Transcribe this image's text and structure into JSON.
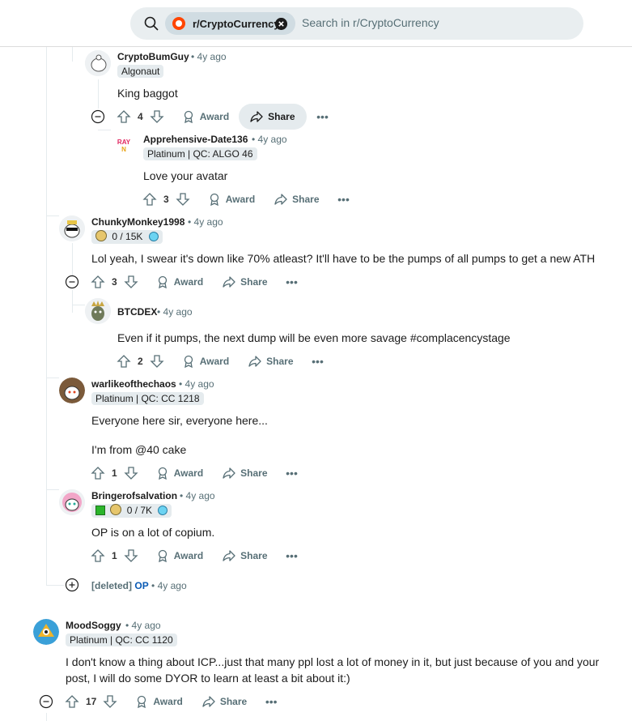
{
  "search": {
    "community": "r/CryptoCurrency",
    "placeholder": "Search in r/CryptoCurrency"
  },
  "comments": [
    {
      "id": "c1",
      "username": "CryptoBumGuy",
      "time": "• 4y ago",
      "flair": "Algonaut",
      "body": "King baggot",
      "votes": "4",
      "award": "Award",
      "share": "Share"
    },
    {
      "id": "c2",
      "username": "Apprehensive-Date136",
      "time": "• 4y ago",
      "flair": "Platinum | QC: ALGO 46",
      "body": "Love your avatar",
      "votes": "3",
      "award": "Award",
      "share": "Share",
      "avatar_text": "RAY N"
    },
    {
      "id": "c3",
      "username": "ChunkyMonkey1998",
      "time": "• 4y ago",
      "flair": "0 / 15K",
      "body": "Lol yeah, I swear it's down like 70% atleast? It'll have to be the pumps of all pumps to get a new ATH",
      "votes": "3",
      "award": "Award",
      "share": "Share"
    },
    {
      "id": "c4",
      "username": "BTCDEX",
      "time": "• 4y ago",
      "body": "Even if it pumps, the next dump will be even more savage #complacencystage",
      "votes": "2",
      "award": "Award",
      "share": "Share"
    },
    {
      "id": "c5",
      "username": "warlikeofthechaos",
      "time": "• 4y ago",
      "flair": "Platinum | QC: CC 1218",
      "body_line1": "Everyone here sir, everyone here...",
      "body_line2": "I'm from @40 cake",
      "votes": "1",
      "award": "Award",
      "share": "Share"
    },
    {
      "id": "c6",
      "username": "Bringerofsalvation",
      "time": "• 4y ago",
      "flair": "0 / 7K",
      "body": "OP is on a lot of copium.",
      "votes": "1",
      "award": "Award",
      "share": "Share"
    },
    {
      "id": "c7",
      "username": "[deleted]",
      "op": "OP",
      "time": "• 4y ago"
    },
    {
      "id": "c8",
      "username": "MoodSoggy",
      "time": "• 4y ago",
      "flair": "Platinum | QC: CC 1120",
      "body_line1": "I don't know a thing about ICP...just that many ppl lost a lot of money in it, but just because of you and your",
      "body_line2": "post, I will do some DYOR to learn at least a bit about it:)",
      "votes": "17",
      "award": "Award",
      "share": "Share"
    }
  ],
  "icons": [
    "search-icon",
    "close-icon",
    "upvote-icon",
    "downvote-icon",
    "award-icon",
    "share-icon",
    "more-icon",
    "collapse-icon",
    "expand-icon"
  ],
  "colors": {
    "accent": "#ff4500",
    "op": "#0a5bb5",
    "meta": "#576f76",
    "flair_bg": "#e5ebee"
  }
}
